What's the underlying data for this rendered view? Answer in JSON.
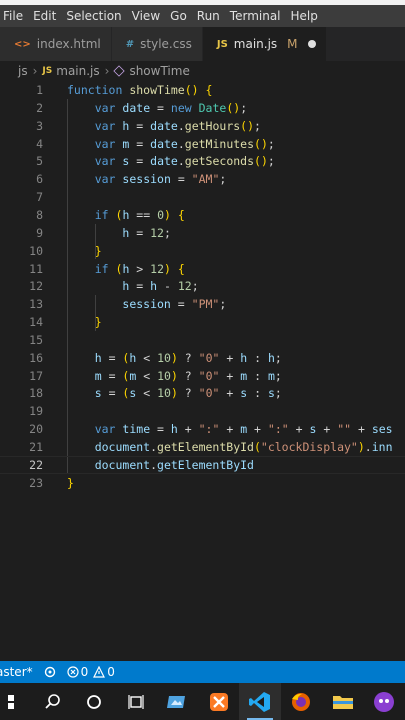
{
  "menu": [
    "File",
    "Edit",
    "Selection",
    "View",
    "Go",
    "Run",
    "Terminal",
    "Help"
  ],
  "tabs": [
    {
      "icon": "<>",
      "label": "index.html",
      "icon_color": "#e37933",
      "active": false
    },
    {
      "icon": "#",
      "label": "style.css",
      "icon_color": "#519aba",
      "active": false
    },
    {
      "icon": "JS",
      "label": "main.js",
      "icon_color": "#e8c547",
      "active": true,
      "modified": "M"
    }
  ],
  "breadcrumb": {
    "folder": "js",
    "file": "main.js",
    "symbol": "showTime",
    "file_badge": "JS"
  },
  "editor": {
    "current_line": 22,
    "lines": [
      {
        "n": "1",
        "text": "function showTime() {"
      },
      {
        "n": "2",
        "text": "    var date = new Date();"
      },
      {
        "n": "3",
        "text": "    var h = date.getHours();"
      },
      {
        "n": "4",
        "text": "    var m = date.getMinutes();"
      },
      {
        "n": "5",
        "text": "    var s = date.getSeconds();"
      },
      {
        "n": "6",
        "text": "    var session = \"AM\";"
      },
      {
        "n": "7",
        "text": ""
      },
      {
        "n": "8",
        "text": "    if (h == 0) {"
      },
      {
        "n": "9",
        "text": "        h = 12;"
      },
      {
        "n": "10",
        "text": "    }"
      },
      {
        "n": "11",
        "text": "    if (h > 12) {"
      },
      {
        "n": "12",
        "text": "        h = h - 12;"
      },
      {
        "n": "13",
        "text": "        session = \"PM\";"
      },
      {
        "n": "14",
        "text": "    }"
      },
      {
        "n": "15",
        "text": ""
      },
      {
        "n": "16",
        "text": "    h = (h < 10) ? \"0\" + h : h;"
      },
      {
        "n": "17",
        "text": "    m = (m < 10) ? \"0\" + m : m;"
      },
      {
        "n": "18",
        "text": "    s = (s < 10) ? \"0\" + s : s;"
      },
      {
        "n": "19",
        "text": ""
      },
      {
        "n": "20",
        "text": "    var time = h + \":\" + m + \":\" + s + \"\" + ses"
      },
      {
        "n": "21",
        "text": "    document.getElementById(\"clockDisplay\").inn"
      },
      {
        "n": "22",
        "text": "    document.getElementById"
      },
      {
        "n": "23",
        "text": "}"
      }
    ]
  },
  "statusbar": {
    "branch": "aster*",
    "errors": "0",
    "warnings": "0"
  },
  "taskbar": [
    "windows-start",
    "search-icon",
    "cortana-icon",
    "task-view-icon",
    "photos-app-icon",
    "xampp-icon",
    "vscode-icon",
    "firefox-icon",
    "file-explorer-icon",
    "app-icon"
  ],
  "colors": {
    "statusbar": "#007acc",
    "editor_bg": "#1e1e1e",
    "keyword": "#569cd6",
    "string": "#ce9178"
  }
}
